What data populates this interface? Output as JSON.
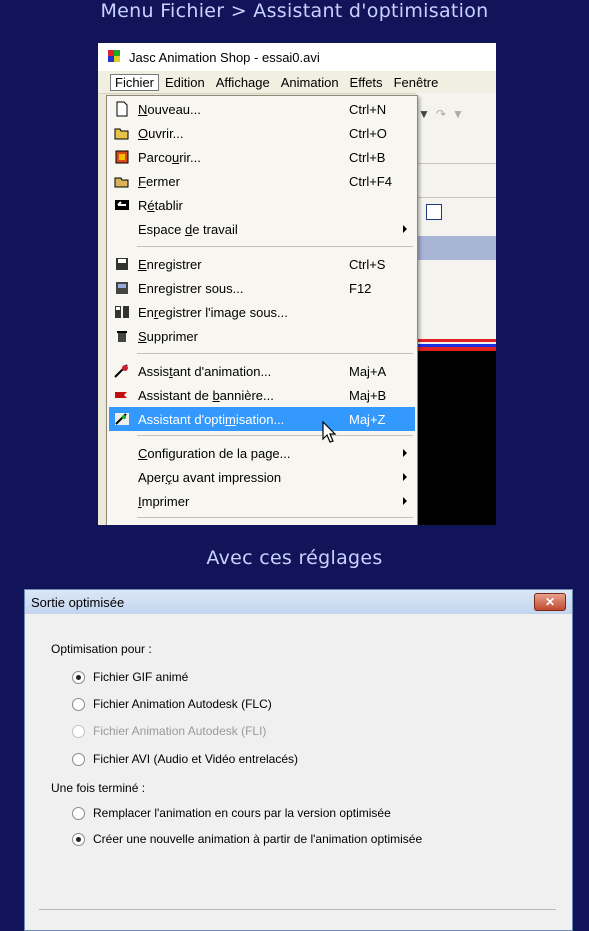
{
  "captions": {
    "top": "Menu Fichier > Assistant d'optimisation",
    "middle": "Avec ces réglages"
  },
  "app": {
    "title": "Jasc Animation Shop - essai0.avi",
    "menubar": [
      "Fichier",
      "Edition",
      "Affichage",
      "Animation",
      "Effets",
      "Fenêtre"
    ],
    "active_menu": "Fichier",
    "menu_items": [
      {
        "pre": "",
        "u": "N",
        "post": "ouveau...",
        "shortcut": "Ctrl+N",
        "icon": "new-file-icon"
      },
      {
        "pre": "",
        "u": "O",
        "post": "uvrir...",
        "shortcut": "Ctrl+O",
        "icon": "open-folder-icon"
      },
      {
        "pre": "Parco",
        "u": "u",
        "post": "rir...",
        "shortcut": "Ctrl+B",
        "icon": "browse-icon"
      },
      {
        "pre": "",
        "u": "F",
        "post": "ermer",
        "shortcut": "Ctrl+F4",
        "icon": "close-folder-icon"
      },
      {
        "pre": "R",
        "u": "é",
        "post": "tablir",
        "shortcut": "",
        "icon": "revert-icon"
      },
      {
        "pre": "Espace ",
        "u": "d",
        "post": "e travail",
        "shortcut": "",
        "icon": "",
        "submenu": true
      },
      {
        "pre": "",
        "u": "E",
        "post": "nregistrer",
        "shortcut": "Ctrl+S",
        "icon": "save-icon"
      },
      {
        "pre": "Enregistrer sous...",
        "u": "",
        "post": "",
        "shortcut": "F12",
        "icon": "save-as-icon"
      },
      {
        "pre": "En",
        "u": "r",
        "post": "egistrer l'image sous...",
        "shortcut": "",
        "icon": "save-frames-icon"
      },
      {
        "pre": "",
        "u": "S",
        "post": "upprimer",
        "shortcut": "",
        "icon": "trash-icon"
      },
      {
        "pre": "Assis",
        "u": "t",
        "post": "ant d'animation...",
        "shortcut": "Maj+A",
        "icon": "animation-wizard-icon"
      },
      {
        "pre": "Assistant de ",
        "u": "b",
        "post": "annière...",
        "shortcut": "Maj+B",
        "icon": "banner-wizard-icon"
      },
      {
        "pre": "Assistant d'opti",
        "u": "m",
        "post": "isation...",
        "shortcut": "Maj+Z",
        "icon": "optimization-wizard-icon",
        "highlighted": true
      },
      {
        "pre": "",
        "u": "C",
        "post": "onfiguration de la page...",
        "shortcut": "",
        "icon": "",
        "submenu": true
      },
      {
        "pre": "Aper",
        "u": "ç",
        "post": "u avant impression",
        "shortcut": "",
        "icon": "",
        "submenu": true
      },
      {
        "pre": "",
        "u": "I",
        "post": "mprimer",
        "shortcut": "",
        "icon": "",
        "submenu": true
      }
    ]
  },
  "dialog": {
    "title": "Sortie optimisée",
    "close_label": "✕",
    "group1_label": "Optimisation pour :",
    "group1_options": [
      {
        "label": "Fichier GIF animé",
        "checked": true,
        "disabled": false
      },
      {
        "label": "Fichier Animation Autodesk (FLC)",
        "checked": false,
        "disabled": false
      },
      {
        "label": "Fichier Animation Autodesk (FLI)",
        "checked": false,
        "disabled": true
      },
      {
        "label": "Fichier AVI (Audio et Vidéo entrelacés)",
        "checked": false,
        "disabled": false
      }
    ],
    "group2_label": "Une fois terminé :",
    "group2_options": [
      {
        "label": "Remplacer l'animation en cours par la version optimisée",
        "checked": false,
        "disabled": false
      },
      {
        "label": "Créer une nouvelle animation à partir de l'animation optimisée",
        "checked": true,
        "disabled": false
      }
    ]
  }
}
